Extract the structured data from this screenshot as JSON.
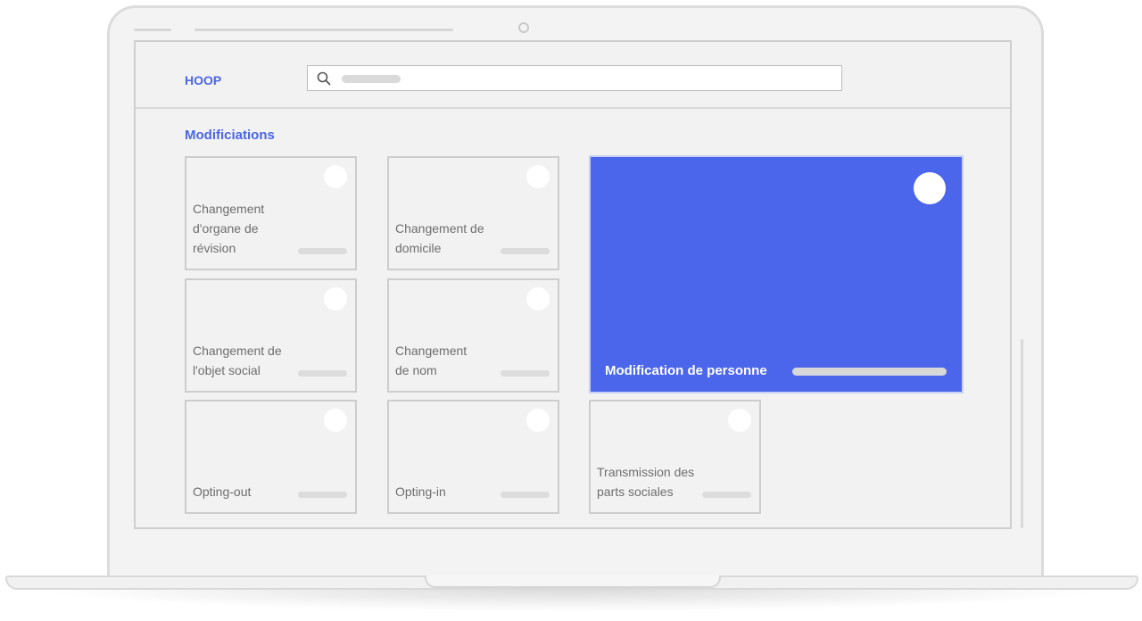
{
  "app": {
    "logo_text": "HOOP"
  },
  "search": {
    "placeholder": ""
  },
  "section": {
    "title": "Modificiations"
  },
  "cards": [
    {
      "label": "Changement d'organe de révision"
    },
    {
      "label": "Changement de domicile"
    },
    {
      "label": "Changement de l'objet social"
    },
    {
      "label": "Changement de nom"
    },
    {
      "label": "Opting-out"
    },
    {
      "label": "Opting-in"
    },
    {
      "label": "Transmission des parts sociales"
    }
  ],
  "featured_card": {
    "label": "Modification de personne"
  },
  "colors": {
    "accent": "#4b66ea",
    "card_bg": "#f2f2f2",
    "border": "#cdcdcd"
  }
}
